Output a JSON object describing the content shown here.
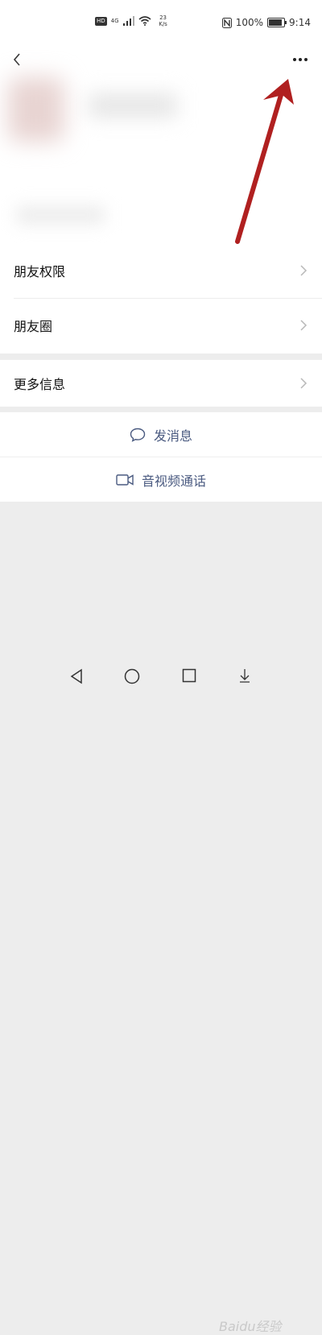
{
  "status_bar": {
    "hd": "HD",
    "network": "4G",
    "speed_value": "23",
    "speed_unit": "K/s",
    "battery": "100%",
    "battery_level": 1.0,
    "time": "9:14"
  },
  "header": {
    "back_icon": "chevron-left-icon",
    "more_icon": "more-dots-icon"
  },
  "menu_items": [
    {
      "label": "朋友权限"
    },
    {
      "label": "朋友圈"
    },
    {
      "label": "更多信息"
    }
  ],
  "actions": {
    "message_label": "发消息",
    "call_label": "音视频通话"
  },
  "nav": {
    "back": "triangle-back-icon",
    "home": "circle-home-icon",
    "recents": "square-recents-icon"
  },
  "watermark": "Baidu经验",
  "colors": {
    "accent_text": "#4a5a80",
    "arrow": "#b02020",
    "background": "#ededed"
  }
}
